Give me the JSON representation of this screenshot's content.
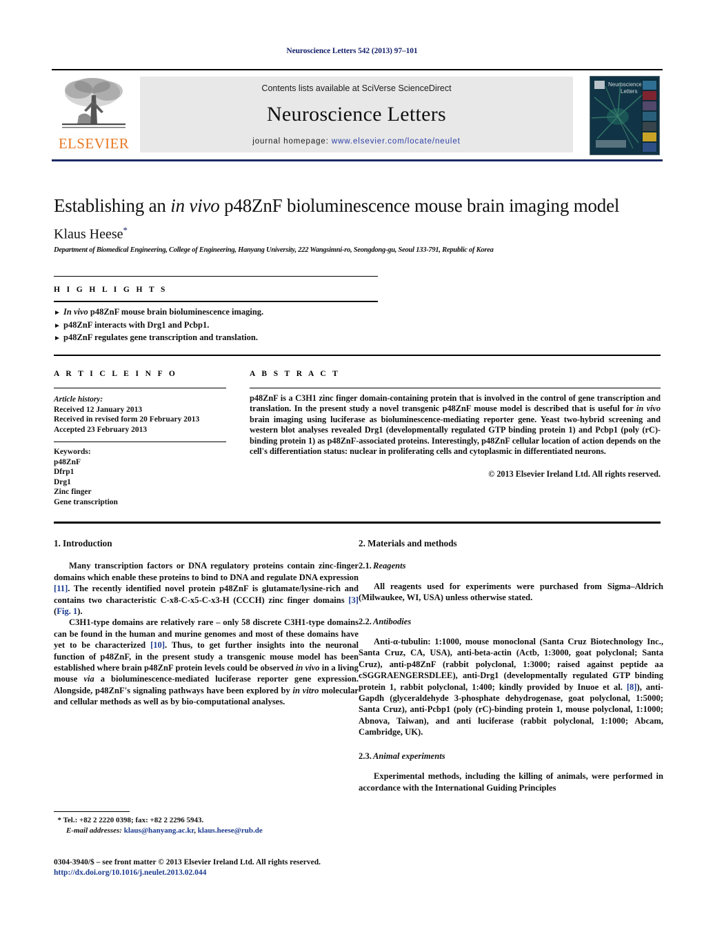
{
  "running_head": "Neuroscience Letters 542 (2013) 97–101",
  "masthead": {
    "contents_prefix": "Contents lists available at ",
    "contents_link": "SciVerse ScienceDirect",
    "journal_name": "Neuroscience Letters",
    "homepage_prefix": "journal homepage: ",
    "homepage_url": "www.elsevier.com/locate/neulet",
    "publisher_wordmark": "ELSEVIER",
    "publisher_logo_icon": "elsevier-tree-icon",
    "cover_thumbnail_icon": "journal-cover-thumbnail",
    "cover_title": "Neuroscience Letters"
  },
  "article": {
    "title_part1": "Establishing an ",
    "title_italic": "in vivo",
    "title_part2": " p48ZnF bioluminescence mouse brain imaging model",
    "author": "Klaus Heese",
    "author_marker": "*",
    "affiliation": "Department of Biomedical Engineering, College of Engineering, Hanyang University, 222 Wangsimni-ro, Seongdong-gu, Seoul 133-791, Republic of Korea"
  },
  "highlights": {
    "label": "H I G H L I G H T S",
    "bullet_glyph": "►",
    "items": [
      {
        "italic": "In vivo",
        "rest": " p48ZnF mouse brain bioluminescence imaging."
      },
      {
        "italic": "",
        "rest": "p48ZnF interacts with Drg1 and Pcbp1."
      },
      {
        "italic": "",
        "rest": "p48ZnF regulates gene transcription and translation."
      }
    ]
  },
  "article_info": {
    "label": "A R T I C L E   I N F O",
    "history_heading": "Article history:",
    "history": [
      "Received 12 January 2013",
      "Received in revised form 20 February 2013",
      "Accepted 23 February 2013"
    ],
    "keywords_heading": "Keywords:",
    "keywords": [
      "p48ZnF",
      "Dfrp1",
      "Drg1",
      "Zinc finger",
      "Gene transcription"
    ]
  },
  "abstract": {
    "label": "A B S T R A C T",
    "p1": "p48ZnF is a C3H1 zinc finger domain-containing protein that is involved in the control of gene transcription and translation. In the present study a novel transgenic p48ZnF mouse model is described that is useful for ",
    "p1_italic": "in vivo",
    "p2": " brain imaging using luciferase as bioluminescence-mediating reporter gene. Yeast two-hybrid screening and western blot analyses revealed Drg1 (developmentally regulated GTP binding protein 1) and Pcbp1 (poly (rC)-binding protein 1) as p48ZnF-associated proteins. Interestingly, p48ZnF cellular location of action depends on the cell's differentiation status: nuclear in proliferating cells and cytoplasmic in differentiated neurons.",
    "copyright": "© 2013 Elsevier Ireland Ltd. All rights reserved."
  },
  "sections": {
    "introduction": {
      "number": "1.",
      "title": "Introduction",
      "para1_a": "Many transcription factors or DNA regulatory proteins contain zinc-finger domains which enable these proteins to bind to DNA and regulate DNA expression ",
      "para1_ref1": "[11]",
      "para1_b": ". The recently identified novel protein p48ZnF is glutamate/lysine-rich and contains two characteristic C-x8-C-x5-C-x3-H (CCCH) zinc finger domains ",
      "para1_ref2": "[3]",
      "para1_c": " (",
      "para1_ref3": "Fig. 1",
      "para1_d": ").",
      "para2_a": "C3H1-type domains are relatively rare – only 58 discrete C3H1-type domains can be found in the human and murine genomes and most of these domains have yet to be characterized ",
      "para2_ref1": "[10]",
      "para2_b": ". Thus, to get further insights into the neuronal function of p48ZnF, in the present study a transgenic mouse model has been established where brain p48ZnF protein levels could be observed ",
      "para2_it1": "in vivo",
      "para2_c": " in a living mouse ",
      "para2_it2": "via",
      "para2_d": " a bioluminescence-mediated luciferase reporter gene expression. Alongside, p48ZnF's signaling pathways have been explored by ",
      "para2_it3": "in vitro",
      "para2_e": " molecular and cellular methods as well as by bio-computational analyses."
    },
    "materials": {
      "number": "2.",
      "title": "Materials and methods",
      "sub1_number": "2.1.",
      "sub1_title": "Reagents",
      "sub1_para": "All reagents used for experiments were purchased from Sigma–Aldrich (Milwaukee, WI, USA) unless otherwise stated.",
      "sub2_number": "2.2.",
      "sub2_title": "Antibodies",
      "sub2_para_a": "Anti-α-tubulin: 1:1000, mouse monoclonal (Santa Cruz Biotechnology Inc., Santa Cruz, CA, USA), anti-beta-actin (Actb, 1:3000, goat polyclonal; Santa Cruz), anti-p48ZnF (rabbit polyclonal, 1:3000; raised against peptide aa cSGGRAENGERSDLEE), anti-Drg1 (developmentally regulated GTP binding protein 1, rabbit polyclonal, 1:400; kindly provided by Inuoe et al. ",
      "sub2_ref": "[8]",
      "sub2_para_b": "), anti-Gapdh (glyceraldehyde 3-phosphate dehydrogenase, goat polyclonal, 1:5000; Santa Cruz), anti-Pcbp1 (poly (rC)-binding protein 1, mouse polyclonal, 1:1000; Abnova, Taiwan), and anti luciferase (rabbit polyclonal, 1:1000; Abcam, Cambridge, UK).",
      "sub3_number": "2.3.",
      "sub3_title": "Animal experiments",
      "sub3_para": "Experimental methods, including the killing of animals, were performed in accordance with the International Guiding Principles"
    }
  },
  "footnote": {
    "marker": "*",
    "contact": "Tel.: +82 2 2220 0398; fax: +82 2 2296 5943.",
    "email_label": "E-mail addresses:",
    "email1": "klaus@hanyang.ac.kr",
    "email_sep": ", ",
    "email2": "klaus.heese@rub.de"
  },
  "footer": {
    "issn_line": "0304-3940/$ – see front matter © 2013 Elsevier Ireland Ltd. All rights reserved.",
    "doi": "http://dx.doi.org/10.1016/j.neulet.2013.02.044"
  },
  "colors": {
    "link": "#2c3fa5",
    "reference": "#1b3a8f",
    "running_head": "#15216b",
    "elsevier_orange": "#E87722",
    "band_bg": "#e8e8e8"
  }
}
